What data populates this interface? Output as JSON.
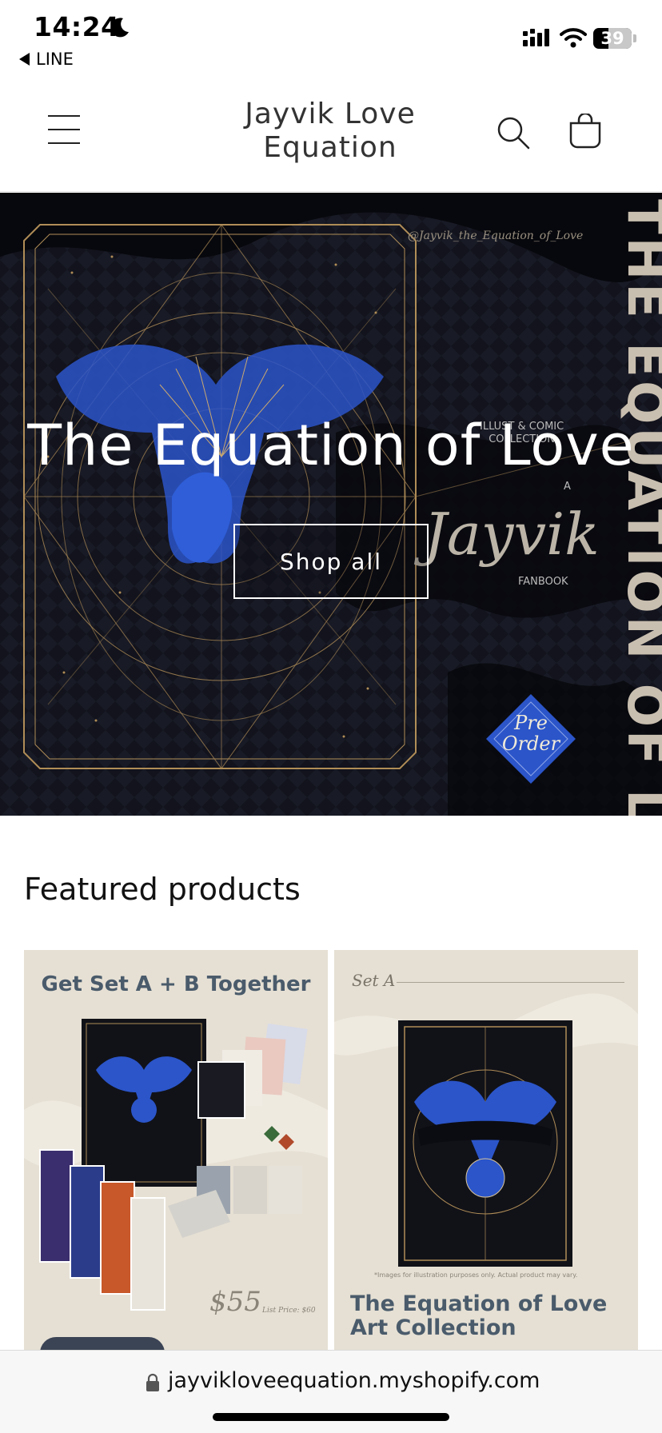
{
  "status_bar": {
    "time": "14:24",
    "back_app": "LINE",
    "battery": "39",
    "battery_level": 0.39,
    "icons": [
      "moon-icon",
      "signal-icon",
      "wifi-icon",
      "battery-icon"
    ]
  },
  "header": {
    "title_line1": "Jayvik Love",
    "title_line2": "Equation",
    "icons": [
      "menu-icon",
      "search-icon",
      "cart-icon"
    ]
  },
  "hero": {
    "heading": "The Equation of Love",
    "button_label": "Shop all",
    "watermark": "@Jayvik_the_Equation_of_Love",
    "vertical_text": "THE EQUATION OF LOVE",
    "collection_line1": "ILLUST & COMIC",
    "collection_line2": "COLLECTION",
    "a_label": "A",
    "script_text": "Jayvik",
    "fanbook_label": "FANBOOK",
    "preorder_line1": "Pre",
    "preorder_line2": "Order",
    "colors": {
      "background": "#0e0f16",
      "gold": "#b08d57",
      "blue": "#2b55c9"
    }
  },
  "featured": {
    "heading": "Featured products",
    "products": [
      {
        "title": "Get Set A + B Together",
        "price": "$55",
        "list_price": "List Price: $60"
      },
      {
        "set_label": "Set A",
        "title_line1": "The Equation of Love",
        "title_line2": "Art Collection",
        "note": "*Images for illustration purposes only. Actual product may vary."
      }
    ]
  },
  "browser": {
    "url": "jayvikloveequation.myshopify.com"
  }
}
